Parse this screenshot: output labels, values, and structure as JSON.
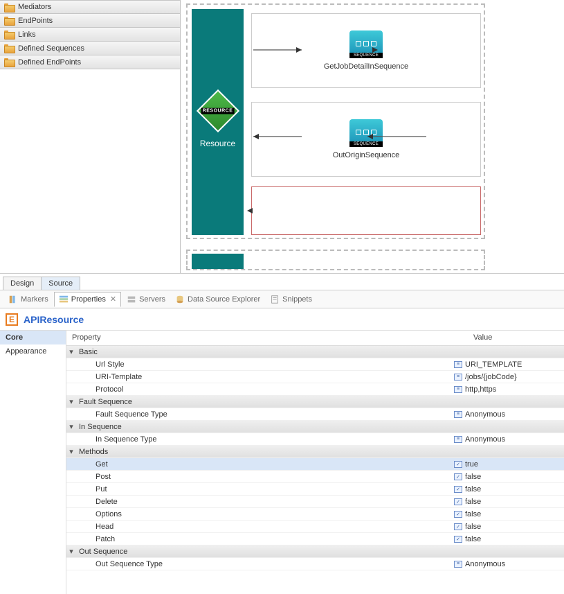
{
  "palette": {
    "items": [
      {
        "label": "Mediators"
      },
      {
        "label": "EndPoints"
      },
      {
        "label": "Links"
      },
      {
        "label": "Defined Sequences"
      },
      {
        "label": "Defined EndPoints"
      }
    ]
  },
  "canvas": {
    "resource_label": "Resource",
    "resource_icon_text": "RESOURCE",
    "in_sequence": {
      "icon_label": "SEQUENCE",
      "caption": "GetJobDetailInSequence"
    },
    "out_sequence": {
      "icon_label": "SEQUENCE",
      "caption": "OutOriginSequence"
    }
  },
  "editor_tabs": {
    "design": "Design",
    "source": "Source",
    "active": "Source"
  },
  "view_tabs": {
    "markers": "Markers",
    "properties": "Properties",
    "servers": "Servers",
    "data_source_explorer": "Data Source Explorer",
    "snippets": "Snippets"
  },
  "properties": {
    "header_title": "APIResource",
    "header_icon_letter": "E",
    "categories": {
      "core": "Core",
      "appearance": "Appearance"
    },
    "columns": {
      "property": "Property",
      "value": "Value"
    },
    "sections": {
      "basic": "Basic",
      "fault_sequence": "Fault Sequence",
      "in_sequence": "In Sequence",
      "methods": "Methods",
      "out_sequence": "Out Sequence"
    },
    "rows": {
      "url_style": {
        "label": "Url Style",
        "value": "URI_TEMPLATE"
      },
      "uri_template": {
        "label": "URI-Template",
        "value": "/jobs/{jobCode}"
      },
      "protocol": {
        "label": "Protocol",
        "value": "http,https"
      },
      "fault_seq_type": {
        "label": "Fault Sequence Type",
        "value": "Anonymous"
      },
      "in_seq_type": {
        "label": "In Sequence Type",
        "value": "Anonymous"
      },
      "get": {
        "label": "Get",
        "value": "true"
      },
      "post": {
        "label": "Post",
        "value": "false"
      },
      "put": {
        "label": "Put",
        "value": "false"
      },
      "delete": {
        "label": "Delete",
        "value": "false"
      },
      "options": {
        "label": "Options",
        "value": "false"
      },
      "head": {
        "label": "Head",
        "value": "false"
      },
      "patch": {
        "label": "Patch",
        "value": "false"
      },
      "out_seq_type": {
        "label": "Out Sequence Type",
        "value": "Anonymous"
      }
    }
  }
}
